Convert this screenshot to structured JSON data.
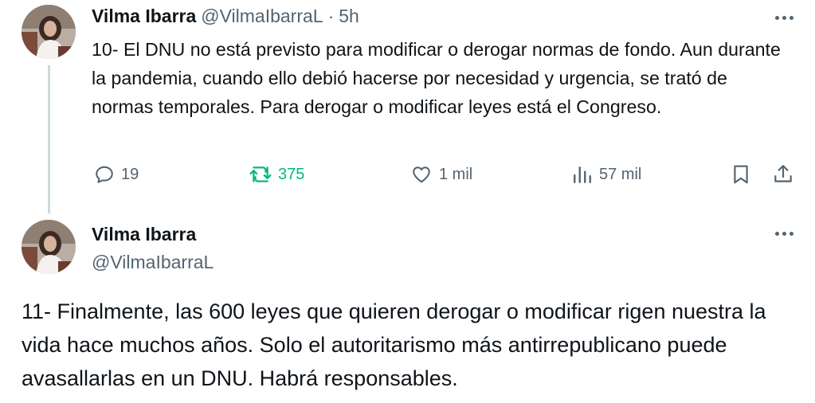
{
  "tweet1": {
    "author_name": "Vilma Ibarra",
    "handle": "@VilmaIbarraL",
    "separator": "·",
    "time": "5h",
    "text": "10- El DNU no está previsto para modificar o derogar normas de fondo. Aun durante la pandemia, cuando ello debió hacerse por necesidad y urgencia, se trató de normas temporales. Para derogar o modificar leyes está el Congreso.",
    "actions": {
      "replies": "19",
      "reposts": "375",
      "likes": "1 mil",
      "views": "57 mil"
    },
    "repost_color": "#00ba7c"
  },
  "tweet2": {
    "author_name": "Vilma Ibarra",
    "handle": "@VilmaIbarraL",
    "text": "11- Finalmente, las 600 leyes que quieren derogar o modificar rigen nuestra la vida hace muchos años. Solo el autoritarismo más antirrepublicano puede avasallarlas en un DNU. Habrá responsables."
  },
  "icons": [
    "avatar-photo",
    "more-icon",
    "reply-icon",
    "repost-icon",
    "like-icon",
    "views-icon",
    "bookmark-icon",
    "share-icon"
  ]
}
